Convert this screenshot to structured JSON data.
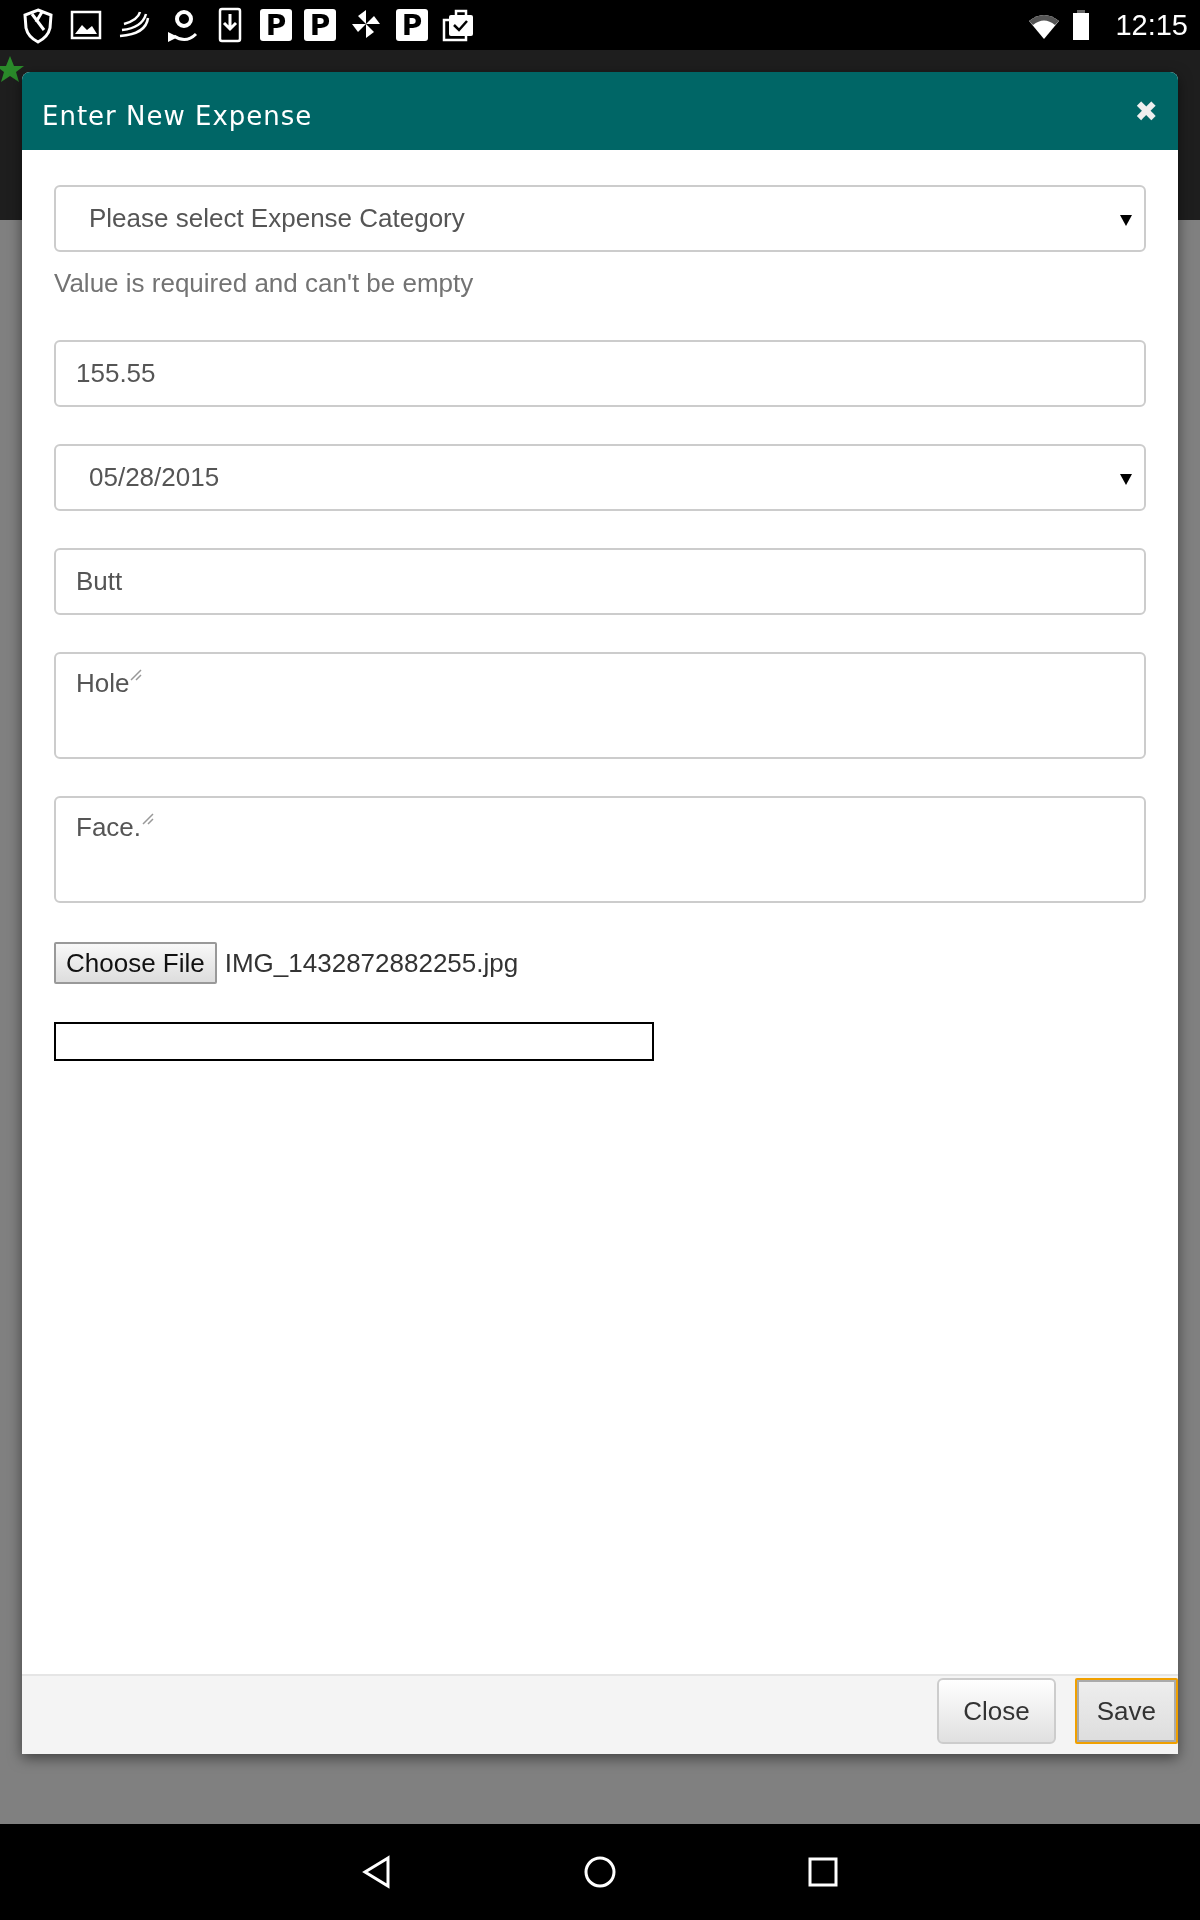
{
  "status_bar": {
    "notifications": [
      {
        "kind": "shield"
      },
      {
        "kind": "image"
      },
      {
        "kind": "swirl"
      },
      {
        "kind": "smile"
      },
      {
        "kind": "download"
      },
      {
        "kind": "letter",
        "letter": "P"
      },
      {
        "kind": "letter",
        "letter": "P"
      },
      {
        "kind": "pinwheel"
      },
      {
        "kind": "letter",
        "letter": "P"
      },
      {
        "kind": "bag"
      }
    ],
    "time": "12:15"
  },
  "dialog": {
    "title": "Enter New Expense",
    "close_glyph": "✖",
    "fields": [
      {
        "kind": "select",
        "value": "Please select Expense Category",
        "error": "Value is required and can't be empty"
      },
      {
        "kind": "input",
        "value": "155.55"
      },
      {
        "kind": "select",
        "value": "05/28/2015"
      },
      {
        "kind": "input",
        "value": "Butt"
      },
      {
        "kind": "textarea",
        "value": "Hole"
      },
      {
        "kind": "textarea",
        "value": "Face."
      }
    ],
    "file": {
      "button": "Choose File",
      "filename": "IMG_1432872882255.jpg"
    },
    "buttons": [
      {
        "label": "Close",
        "focused": false
      },
      {
        "label": "Save",
        "focused": true
      }
    ]
  }
}
